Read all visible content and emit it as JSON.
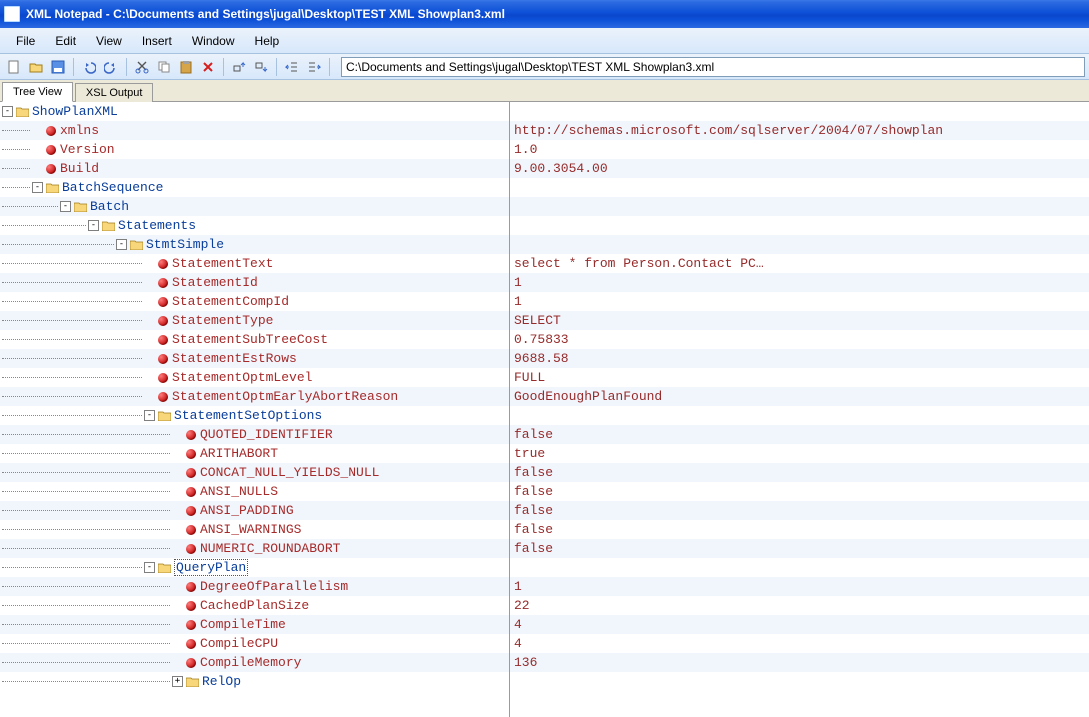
{
  "title": "XML Notepad - C:\\Documents and Settings\\jugal\\Desktop\\TEST XML Showplan3.xml",
  "menus": [
    "File",
    "Edit",
    "View",
    "Insert",
    "Window",
    "Help"
  ],
  "address": "C:\\Documents and Settings\\jugal\\Desktop\\TEST XML Showplan3.xml",
  "tabs": {
    "tree": "Tree View",
    "xsl": "XSL Output"
  },
  "rows": [
    {
      "depth": 0,
      "kind": "elem",
      "exp": "-",
      "label": "ShowPlanXML",
      "val": "",
      "alt": false
    },
    {
      "depth": 1,
      "kind": "attr",
      "exp": "",
      "label": "xmlns",
      "val": "http://schemas.microsoft.com/sqlserver/2004/07/showplan",
      "alt": true
    },
    {
      "depth": 1,
      "kind": "attr",
      "exp": "",
      "label": "Version",
      "val": "1.0",
      "alt": false
    },
    {
      "depth": 1,
      "kind": "attr",
      "exp": "",
      "label": "Build",
      "val": "9.00.3054.00",
      "alt": true
    },
    {
      "depth": 1,
      "kind": "elem",
      "exp": "-",
      "label": "BatchSequence",
      "val": "",
      "alt": false
    },
    {
      "depth": 2,
      "kind": "elem",
      "exp": "-",
      "label": "Batch",
      "val": "",
      "alt": true
    },
    {
      "depth": 3,
      "kind": "elem",
      "exp": "-",
      "label": "Statements",
      "val": "",
      "alt": false
    },
    {
      "depth": 4,
      "kind": "elem",
      "exp": "-",
      "label": "StmtSimple",
      "val": "",
      "alt": true
    },
    {
      "depth": 5,
      "kind": "attr",
      "exp": "",
      "label": "StatementText",
      "val": "select * from Person.Contact PC…",
      "alt": false
    },
    {
      "depth": 5,
      "kind": "attr",
      "exp": "",
      "label": "StatementId",
      "val": "1",
      "alt": true
    },
    {
      "depth": 5,
      "kind": "attr",
      "exp": "",
      "label": "StatementCompId",
      "val": "1",
      "alt": false
    },
    {
      "depth": 5,
      "kind": "attr",
      "exp": "",
      "label": "StatementType",
      "val": "SELECT",
      "alt": true
    },
    {
      "depth": 5,
      "kind": "attr",
      "exp": "",
      "label": "StatementSubTreeCost",
      "val": "0.75833",
      "alt": false
    },
    {
      "depth": 5,
      "kind": "attr",
      "exp": "",
      "label": "StatementEstRows",
      "val": "9688.58",
      "alt": true
    },
    {
      "depth": 5,
      "kind": "attr",
      "exp": "",
      "label": "StatementOptmLevel",
      "val": "FULL",
      "alt": false
    },
    {
      "depth": 5,
      "kind": "attr",
      "exp": "",
      "label": "StatementOptmEarlyAbortReason",
      "val": "GoodEnoughPlanFound",
      "alt": true
    },
    {
      "depth": 5,
      "kind": "elem",
      "exp": "-",
      "label": "StatementSetOptions",
      "val": "",
      "alt": false
    },
    {
      "depth": 6,
      "kind": "attr",
      "exp": "",
      "label": "QUOTED_IDENTIFIER",
      "val": "false",
      "alt": true
    },
    {
      "depth": 6,
      "kind": "attr",
      "exp": "",
      "label": "ARITHABORT",
      "val": "true",
      "alt": false
    },
    {
      "depth": 6,
      "kind": "attr",
      "exp": "",
      "label": "CONCAT_NULL_YIELDS_NULL",
      "val": "false",
      "alt": true
    },
    {
      "depth": 6,
      "kind": "attr",
      "exp": "",
      "label": "ANSI_NULLS",
      "val": "false",
      "alt": false
    },
    {
      "depth": 6,
      "kind": "attr",
      "exp": "",
      "label": "ANSI_PADDING",
      "val": "false",
      "alt": true
    },
    {
      "depth": 6,
      "kind": "attr",
      "exp": "",
      "label": "ANSI_WARNINGS",
      "val": "false",
      "alt": false
    },
    {
      "depth": 6,
      "kind": "attr",
      "exp": "",
      "label": "NUMERIC_ROUNDABORT",
      "val": "false",
      "alt": true
    },
    {
      "depth": 5,
      "kind": "elem",
      "exp": "-",
      "label": "QueryPlan",
      "val": "",
      "alt": false,
      "selected": true
    },
    {
      "depth": 6,
      "kind": "attr",
      "exp": "",
      "label": "DegreeOfParallelism",
      "val": "1",
      "alt": true
    },
    {
      "depth": 6,
      "kind": "attr",
      "exp": "",
      "label": "CachedPlanSize",
      "val": "22",
      "alt": false
    },
    {
      "depth": 6,
      "kind": "attr",
      "exp": "",
      "label": "CompileTime",
      "val": "4",
      "alt": true
    },
    {
      "depth": 6,
      "kind": "attr",
      "exp": "",
      "label": "CompileCPU",
      "val": "4",
      "alt": false
    },
    {
      "depth": 6,
      "kind": "attr",
      "exp": "",
      "label": "CompileMemory",
      "val": "136",
      "alt": true
    },
    {
      "depth": 6,
      "kind": "elem",
      "exp": "+",
      "label": "RelOp",
      "val": "",
      "alt": false
    }
  ]
}
